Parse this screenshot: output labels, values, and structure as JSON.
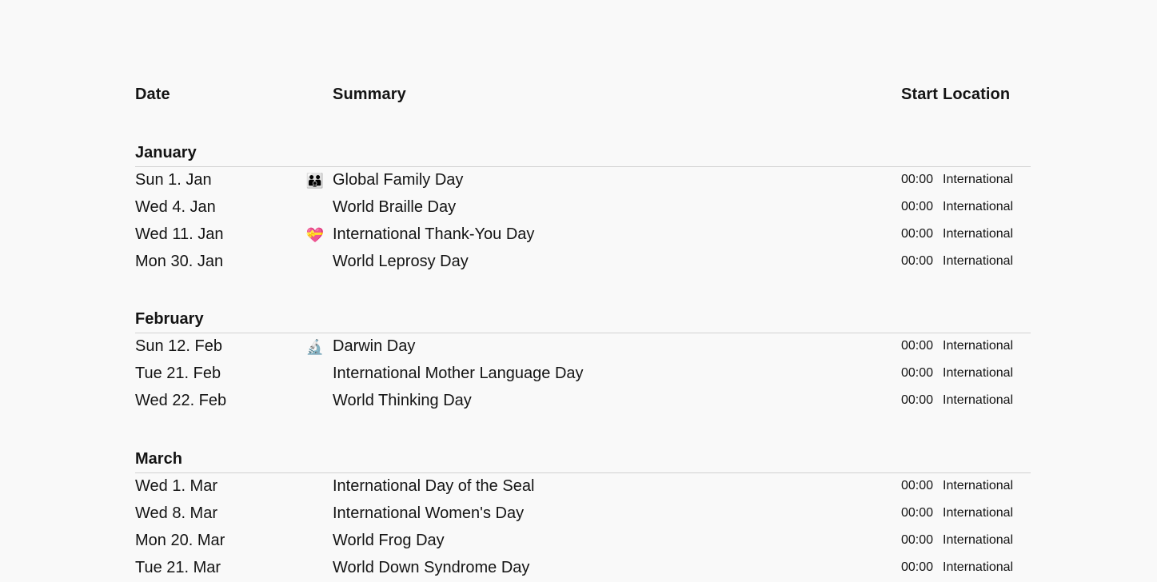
{
  "header": {
    "date": "Date",
    "summary": "Summary",
    "start": "Start",
    "location": "Location"
  },
  "sections": [
    {
      "month": "January",
      "rows": [
        {
          "date": "Sun 1. Jan",
          "icon": "family-icon",
          "emoji": "👪",
          "summary": "Global Family Day",
          "start": "00:00",
          "location": "International"
        },
        {
          "date": "Wed 4. Jan",
          "icon": "",
          "emoji": "",
          "summary": "World Braille Day",
          "start": "00:00",
          "location": "International"
        },
        {
          "date": "Wed 11. Jan",
          "icon": "heart-icon",
          "emoji": "💝",
          "summary": "International Thank-You Day",
          "start": "00:00",
          "location": "International"
        },
        {
          "date": "Mon 30. Jan",
          "icon": "",
          "emoji": "",
          "summary": "World Leprosy Day",
          "start": "00:00",
          "location": "International"
        }
      ]
    },
    {
      "month": "February",
      "rows": [
        {
          "date": "Sun 12. Feb",
          "icon": "microscope-icon",
          "emoji": "🔬",
          "summary": "Darwin Day",
          "start": "00:00",
          "location": "International"
        },
        {
          "date": "Tue 21. Feb",
          "icon": "",
          "emoji": "",
          "summary": "International Mother Language Day",
          "start": "00:00",
          "location": "International"
        },
        {
          "date": "Wed 22. Feb",
          "icon": "",
          "emoji": "",
          "summary": "World Thinking Day",
          "start": "00:00",
          "location": "International"
        }
      ]
    },
    {
      "month": "March",
      "rows": [
        {
          "date": "Wed 1. Mar",
          "icon": "",
          "emoji": "",
          "summary": "International Day of the Seal",
          "start": "00:00",
          "location": "International"
        },
        {
          "date": "Wed 8. Mar",
          "icon": "",
          "emoji": "",
          "summary": "International Women's Day",
          "start": "00:00",
          "location": "International"
        },
        {
          "date": "Mon 20. Mar",
          "icon": "",
          "emoji": "",
          "summary": "World Frog Day",
          "start": "00:00",
          "location": "International"
        },
        {
          "date": "Tue 21. Mar",
          "icon": "",
          "emoji": "",
          "summary": "World Down Syndrome Day",
          "start": "00:00",
          "location": "International"
        }
      ]
    }
  ]
}
